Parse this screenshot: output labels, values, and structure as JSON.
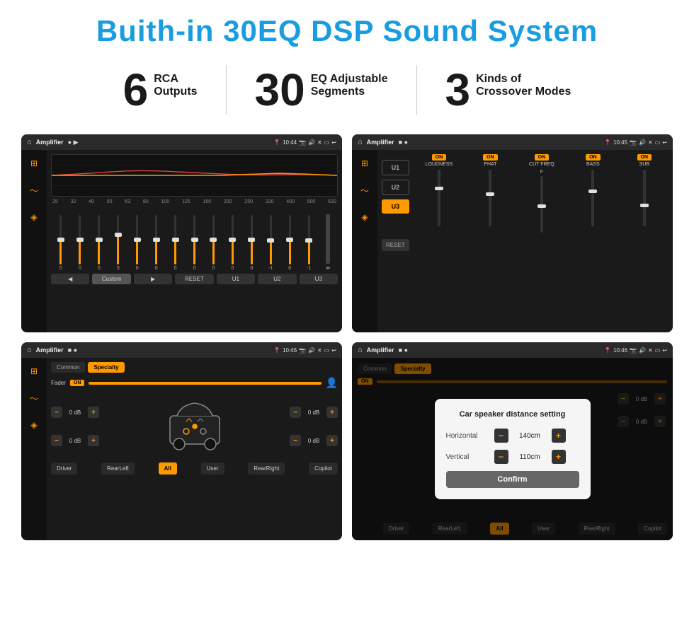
{
  "title": "Buith-in 30EQ DSP Sound System",
  "stats": [
    {
      "number": "6",
      "label_top": "RCA",
      "label_bottom": "Outputs"
    },
    {
      "number": "30",
      "label_top": "EQ Adjustable",
      "label_bottom": "Segments"
    },
    {
      "number": "3",
      "label_top": "Kinds of",
      "label_bottom": "Crossover Modes"
    }
  ],
  "screens": {
    "eq": {
      "app_name": "Amplifier",
      "time": "10:44",
      "freq_labels": [
        "25",
        "32",
        "40",
        "50",
        "63",
        "80",
        "100",
        "125",
        "160",
        "200",
        "250",
        "320",
        "400",
        "500",
        "630"
      ],
      "slider_values": [
        "0",
        "0",
        "0",
        "5",
        "0",
        "0",
        "0",
        "0",
        "0",
        "0",
        "0",
        "-1",
        "0",
        "-1"
      ],
      "bottom_btns": [
        "◀",
        "Custom",
        "▶",
        "RESET",
        "U1",
        "U2",
        "U3"
      ]
    },
    "crossover": {
      "app_name": "Amplifier",
      "time": "10:45",
      "presets": [
        "U1",
        "U2",
        "U3"
      ],
      "params": [
        "LOUDNESS",
        "PHAT",
        "CUT FREQ",
        "BASS",
        "SUB"
      ],
      "reset_label": "RESET"
    },
    "speaker": {
      "app_name": "Amplifier",
      "time": "10:46",
      "tabs": [
        "Common",
        "Specialty"
      ],
      "fader_label": "Fader",
      "fader_on": "ON",
      "db_values": [
        "0 dB",
        "0 dB",
        "0 dB",
        "0 dB"
      ],
      "bottom_btns": [
        "Driver",
        "RearLeft",
        "All",
        "User",
        "RearRight",
        "Copilot"
      ]
    },
    "distance": {
      "app_name": "Amplifier",
      "time": "10:46",
      "tabs": [
        "Common",
        "Specialty"
      ],
      "dialog_title": "Car speaker distance setting",
      "horizontal_label": "Horizontal",
      "horizontal_value": "140cm",
      "vertical_label": "Vertical",
      "vertical_value": "110cm",
      "confirm_label": "Confirm",
      "bottom_btns": [
        "Driver",
        "RearLeft",
        "All",
        "User",
        "RearRight",
        "Copilot"
      ],
      "db_values": [
        "0 dB",
        "0 dB"
      ]
    }
  },
  "colors": {
    "accent_blue": "#1a9de0",
    "accent_orange": "#f90",
    "bg_dark": "#1a1a1a",
    "bg_darker": "#111111"
  }
}
